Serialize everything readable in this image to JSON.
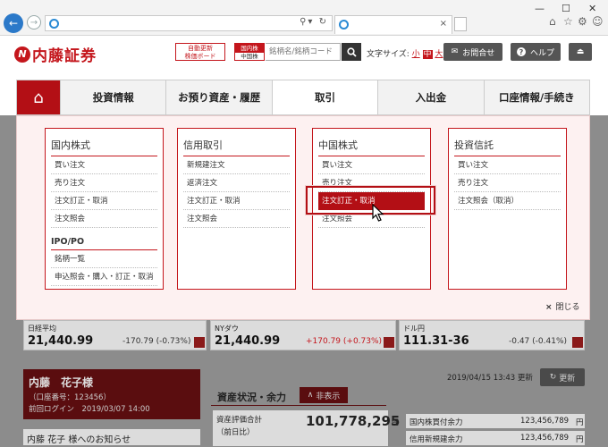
{
  "browser": {
    "tab_close": "×",
    "minimize": "—",
    "maximize": "☐",
    "close": "✕"
  },
  "header": {
    "logo_text": "内藤証券",
    "auto_board_line1": "自動更新",
    "auto_board_line2": "株価ボード",
    "stock_type_a": "国内株",
    "stock_type_b": "中国株",
    "search_placeholder": "銘柄名/銘柄コード",
    "font_size_label": "文字サイズ:",
    "font_small": "小",
    "font_medium": "中",
    "font_large": "大",
    "contact_label": "お問合せ",
    "help_label": "ヘルプ"
  },
  "nav": {
    "items": [
      "投資情報",
      "お預り資産・履歴",
      "取引",
      "入出金",
      "口座情報/手続き"
    ],
    "active": "取引"
  },
  "mega_menu": {
    "columns": [
      {
        "title": "国内株式",
        "items": [
          "買い注文",
          "売り注文",
          "注文訂正・取消",
          "注文照会"
        ],
        "subtitle": "IPO/PO",
        "sub_items": [
          "銘柄一覧",
          "申込照会・購入・訂正・取消"
        ]
      },
      {
        "title": "信用取引",
        "items": [
          "新規建注文",
          "返済注文",
          "注文訂正・取消",
          "注文照会"
        ]
      },
      {
        "title": "中国株式",
        "items": [
          "買い注文",
          "売り注文",
          "注文訂正・取消",
          "注文照会"
        ],
        "highlighted": "注文訂正・取消"
      },
      {
        "title": "投資信託",
        "items": [
          "買い注文",
          "売り注文",
          "注文照会（取消）"
        ]
      }
    ],
    "close_label": "閉じる"
  },
  "tickers": [
    {
      "name": "日経平均",
      "value": "21,440.99",
      "change": "-170.79 (-0.73%)",
      "color": "#333333"
    },
    {
      "name": "NYダウ",
      "value": "21,440.99",
      "change": "+170.79 (+0.73%)",
      "color": "#c4161c"
    },
    {
      "name": "ドル円",
      "value": "111.31-36",
      "change": "-0.47 (-0.41%)",
      "color": "#333333"
    }
  ],
  "account": {
    "name": "内藤　花子様",
    "account_no": "（口座番号：123456）",
    "last_login": "前回ログイン　2019/03/07 14:00",
    "notice": "内藤 花子 様へのお知らせ"
  },
  "assets": {
    "title": "資産状況・余力",
    "toggle": "非表示",
    "updated": "2019/04/15 13:43 更新",
    "refresh": "更新",
    "total_label": "資産評価合計",
    "prev_label": "（前日比）",
    "total_value": "101,778,295",
    "total_unit": "円",
    "row1_label": "国内株買付余力",
    "row1_value": "123,456,789",
    "row2_label": "信用新規建余力",
    "row2_value": "123,456,789",
    "unit": "円"
  }
}
